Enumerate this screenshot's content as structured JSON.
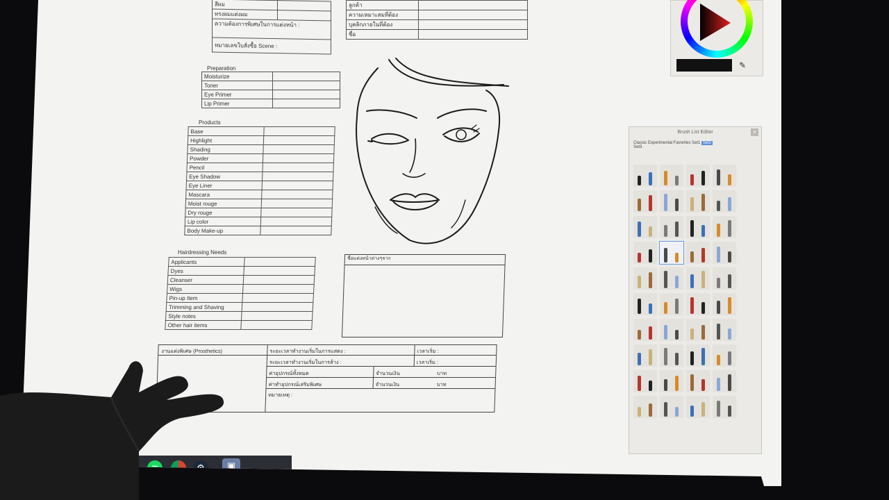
{
  "top_left_table": {
    "rows": [
      "สีผม",
      "ทรงผมแต่งผม",
      "ความต้องการพิเศษในการแต่งหน้า :",
      "หมายเลขใบสั่งซื้อ Scene :"
    ]
  },
  "top_right_table": {
    "rows": [
      "ลูกค้า",
      "ความเหมาะสมที่ต้อง",
      "บุคลิกภายในที่ต้อง",
      "ชื่อ"
    ]
  },
  "preparation": {
    "title": "Preparation",
    "rows": [
      "Moisturize",
      "Toner",
      "Eye Primer",
      "Lip Primer"
    ]
  },
  "products": {
    "title": "Products",
    "rows": [
      "Base",
      "Highlight",
      "Shading",
      "Powder",
      "Pencil",
      "Eye Shadow",
      "Eye Liner",
      "Mascara",
      "Moist rouge",
      "Dry rouge",
      "Lip color",
      "Body Make-up"
    ]
  },
  "hairdressing": {
    "title": "Hairdressing Needs",
    "rows": [
      "Applicants",
      "Dyes",
      "Cleanser",
      "Wigs",
      "Pin-up Item",
      "Trimming and Shaving",
      "Style notes",
      "Other hair items"
    ]
  },
  "notes_box": {
    "header": "ชื่อแต่งหน้าต่างๆจาก"
  },
  "prosthetics": {
    "title": "งานแต่งพิเศษ  (Prosthetics)",
    "row1": "ระยะเวลาทำงานเริ่มในการแสดง :",
    "row1_time": "เวลาเริ่ม :",
    "row2": "ระยะเวลาทำงานเริ่มในการล้าง :",
    "row2_time": "เวลาเริ่ม :",
    "row3": "ค่าอุปกรณ์ทั้งหมด",
    "row3_mid": "จำนวนเงิน",
    "row3_unit": "บาท",
    "row4": "ค่าทำอุปกรณ์เสริมพิเศษ",
    "row4_mid": "จำนวนเงิน",
    "row4_unit": "บาท",
    "row5": "หมายเหตุ :"
  },
  "brush_panel": {
    "title": "Brush List Editor",
    "close": "×",
    "tabs": "Classic  Experimental  Favorites  Set1",
    "active_tab": "Set2",
    "tabs_tail": "Set3",
    "brush_count": 40
  },
  "color_panel": {
    "active_color": "#111111"
  },
  "taskbar": {
    "icons": [
      "start-icon",
      "vlc-icon",
      "spotify-icon",
      "chrome-icon",
      "steam-icon",
      "sketchbook-icon"
    ]
  },
  "colors": {
    "screen_bg": "#f3f3f1",
    "bezel": "#0b0b0d",
    "panel_bg": "#eceae6",
    "taskbar": "#2b2e34",
    "accent_blue": "#5b8fd8"
  }
}
